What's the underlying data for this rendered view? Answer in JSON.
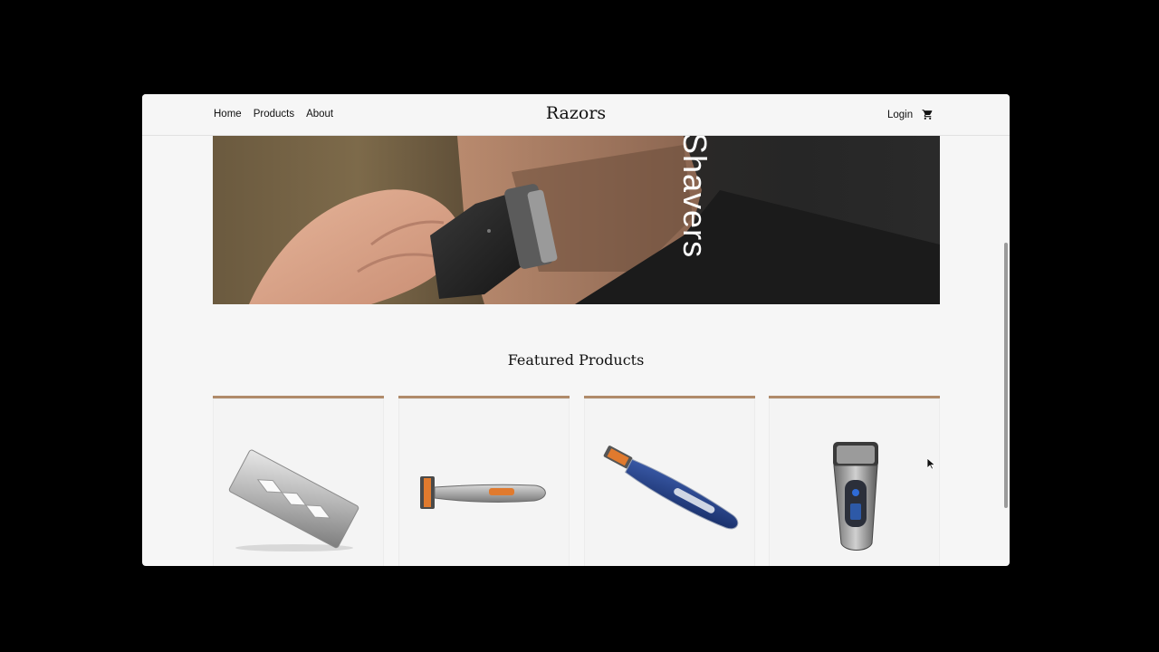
{
  "nav": {
    "links": [
      "Home",
      "Products",
      "About"
    ],
    "brand": "Razors",
    "login": "Login",
    "cart_icon": "cart-icon"
  },
  "hero": {
    "word": "Shavers"
  },
  "featured": {
    "title": "Featured Products",
    "products": [
      {
        "icon": "razor-blade-icon"
      },
      {
        "icon": "cartridge-razor-orange-icon"
      },
      {
        "icon": "cartridge-razor-blue-icon"
      },
      {
        "icon": "electric-shaver-icon"
      }
    ]
  },
  "colors": {
    "accent": "#b08b6a",
    "background": "#f6f6f6",
    "text": "#111111"
  }
}
